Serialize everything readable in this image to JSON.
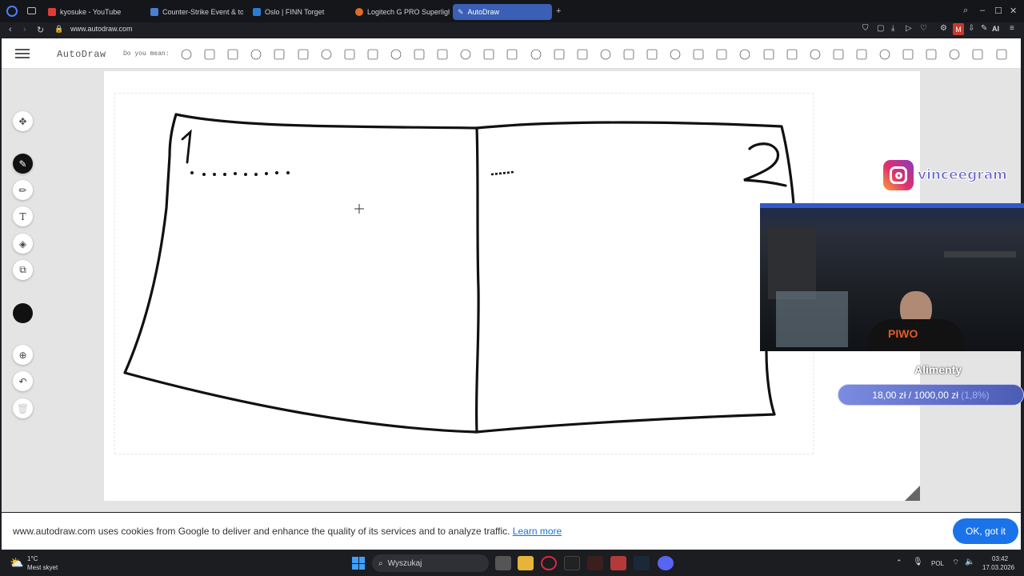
{
  "tabs": [
    {
      "title": "kyosuke - YouTube",
      "color": "#e23b3b"
    },
    {
      "title": "Counter-Strike Event & to",
      "color": "#4a7fd1"
    },
    {
      "title": "Oslo | FINN Torget",
      "color": "#2e7bd6"
    },
    {
      "title": "Logitech G PRO Superligh",
      "color": "#e06b2a"
    },
    {
      "title": "AutoDraw",
      "color": "#6fa2ff",
      "active": true
    }
  ],
  "address": {
    "url": "www.autodraw.com"
  },
  "extensions": {
    "ai_label": "AI",
    "m_badge": "M"
  },
  "app": {
    "brand": "AutoDraw",
    "did_you_mean": "Do you mean:"
  },
  "tools": [
    "move-icon",
    "autodraw-icon",
    "draw-icon",
    "type-icon",
    "fill-icon",
    "shape-icon"
  ],
  "drawing": {
    "label_left": "1",
    "label_right": "2"
  },
  "overlay": {
    "instagram_handle": "vinceegram",
    "goal_title": "Alimenty",
    "goal_current": "18,00 zł",
    "goal_separator": "/",
    "goal_target": "1000,00 zł",
    "goal_percent": "(1,8%)",
    "goal_progress": 0.018
  },
  "cookie": {
    "text": "www.autodraw.com uses cookies from Google to deliver and enhance the quality of its services and to analyze traffic.",
    "link": "Learn more",
    "button": "OK, got it"
  },
  "taskbar": {
    "temp": "1°C",
    "weather": "Mest skyet",
    "search": "Wyszukaj",
    "lang": "POL",
    "time": "03:42",
    "date": "17.03.2026"
  }
}
